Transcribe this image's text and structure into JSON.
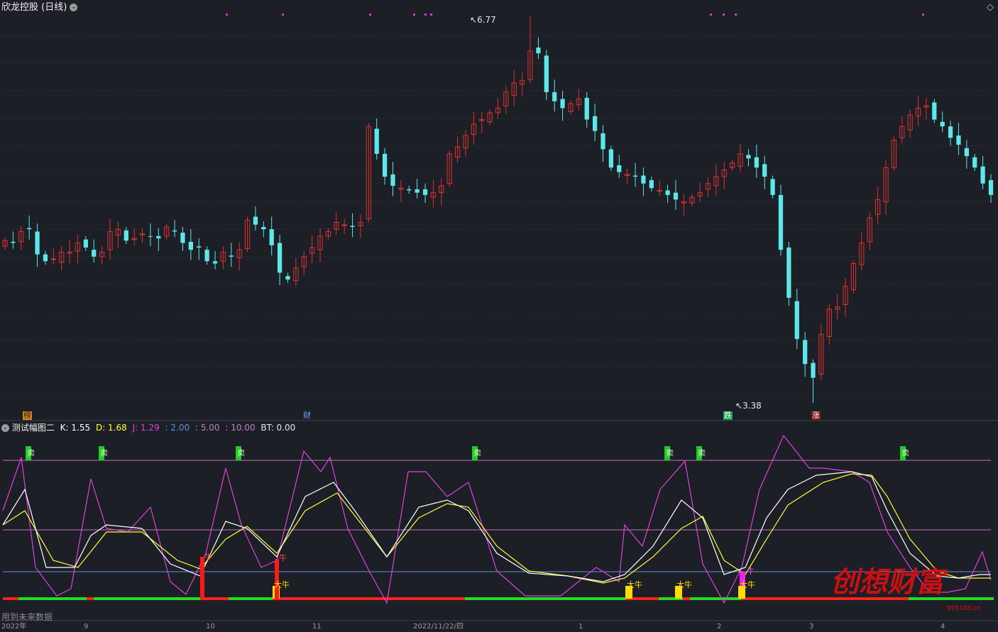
{
  "main_panel": {
    "title": "欣龙控股",
    "period": "(日线)",
    "high_label": "6.77",
    "low_label": "3.38",
    "event_badges": [
      {
        "text": "榜",
        "color": "#d98a1a"
      },
      {
        "text": "财",
        "color": "#6aa6ff"
      },
      {
        "text": "跌",
        "color": "#16a34a"
      },
      {
        "text": "涨",
        "color": "#b91c1c"
      }
    ]
  },
  "indicator_panel": {
    "name": "测试幅图二",
    "k_label": "K: 1.55",
    "d_label": "D: 1.68",
    "j_label": "J: 1.29",
    "l2_label": ": 2.00",
    "l5_label": ": 5.00",
    "l10_label": ": 10.00",
    "bt_label": "BT: 0.00",
    "sell_text": "卖",
    "bull_text": "大牛",
    "up_text": "牛",
    "footer_note": "用到未来数据",
    "watermark": "创想财富",
    "watermark_url": "995168.cn"
  },
  "time_axis": [
    "2022年",
    "9",
    "10",
    "11",
    "2022/11/22/四",
    "1",
    "2",
    "3",
    "4"
  ],
  "colors": {
    "up": "#e03030",
    "down": "#5ce8ea",
    "k_line": "#ffffff",
    "d_line": "#ffff33",
    "j_line": "#e040e0",
    "sell": "#22cc22",
    "bull": "#ffdd00"
  },
  "chart_data": {
    "type": "candlestick",
    "ohlc_close": [
      4.8,
      4.78,
      4.88,
      4.9,
      4.68,
      4.62,
      4.64,
      4.7,
      4.7,
      4.78,
      4.74,
      4.66,
      4.7,
      4.88,
      4.9,
      4.8,
      4.82,
      4.86,
      4.84,
      4.82,
      4.92,
      4.88,
      4.78,
      4.72,
      4.74,
      4.62,
      4.6,
      4.7,
      4.66,
      4.72,
      4.98,
      4.94,
      4.9,
      4.76,
      4.52,
      4.46,
      4.56,
      4.66,
      4.74,
      4.84,
      4.88,
      4.96,
      4.94,
      4.92,
      4.96,
      5.8,
      5.56,
      5.36,
      5.28,
      5.26,
      5.24,
      5.22,
      5.2,
      5.22,
      5.28,
      5.56,
      5.62,
      5.72,
      5.82,
      5.86,
      5.92,
      5.96,
      6.1,
      6.18,
      6.2,
      6.46,
      6.44,
      6.1,
      6.02,
      5.96,
      6.0,
      6.04,
      5.86,
      5.76,
      5.6,
      5.44,
      5.4,
      5.38,
      5.36,
      5.3,
      5.26,
      5.24,
      5.2,
      5.16,
      5.14,
      5.18,
      5.22,
      5.3,
      5.36,
      5.42,
      5.48,
      5.56,
      5.52,
      5.44,
      5.36,
      5.2,
      4.72,
      4.3,
      3.94,
      3.72,
      3.6,
      3.98,
      4.2,
      4.22,
      4.4,
      4.6,
      4.78,
      5.0,
      5.16,
      5.44,
      5.68,
      5.8,
      5.9,
      5.96,
      5.98,
      5.86,
      5.8,
      5.7,
      5.64,
      5.54,
      5.44,
      5.3,
      5.2
    ],
    "visible_high": 6.77,
    "visible_low": 3.38,
    "indicator": {
      "K": 1.55,
      "D": 1.68,
      "J": 1.29,
      "levels": [
        2.0,
        5.0,
        10.0
      ]
    }
  }
}
